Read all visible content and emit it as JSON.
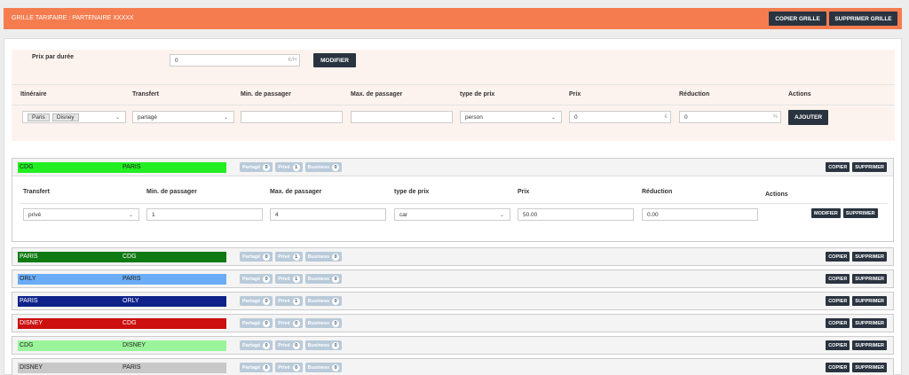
{
  "header": {
    "title": "GRILLE TARIFAIRE :  PARTENAIRE XXXXX",
    "copy_label": "COPIER GRILLE",
    "delete_label": "SUPPRIMER GRILLE"
  },
  "price_duration": {
    "label": "Prix par durée",
    "value": "0",
    "unit": "€/H",
    "button": "MODIFIER"
  },
  "form": {
    "headers": [
      "Itinéraire",
      "Transfert",
      "Min. de passager",
      "Max. de passager",
      "type de prix",
      "Prix",
      "Réduction",
      "Actions"
    ],
    "itinerary_tags": [
      "Paris",
      "Disney"
    ],
    "transfert": "partagé",
    "min": "",
    "max": "",
    "price_type": "person",
    "price": "0",
    "price_unit": "€",
    "reduction": "0",
    "reduction_unit": "%",
    "add_button": "AJOUTER"
  },
  "badge_labels": {
    "partage": "Partagé",
    "prive": "Privé",
    "business": "Business"
  },
  "route_buttons": {
    "copy": "COPIER",
    "delete": "SUPPRIMER"
  },
  "routes": [
    {
      "from": "CDG",
      "to": "PARIS",
      "color": "#22ee22",
      "text": "#222222",
      "partage": "0",
      "prive": "1",
      "business": "0"
    },
    {
      "from": "PARIS",
      "to": "CDG",
      "color": "#0f7a12",
      "text": "#ffffff",
      "partage": "0",
      "prive": "1",
      "business": "0"
    },
    {
      "from": "ORLY",
      "to": "PARIS",
      "color": "#6aacf5",
      "text": "#222222",
      "partage": "0",
      "prive": "1",
      "business": "0"
    },
    {
      "from": "PARIS",
      "to": "ORLY",
      "color": "#0f228a",
      "text": "#ffffff",
      "partage": "0",
      "prive": "1",
      "business": "0"
    },
    {
      "from": "DISNEY",
      "to": "CDG",
      "color": "#cc0f0f",
      "text": "#ffffff",
      "partage": "0",
      "prive": "0",
      "business": "0"
    },
    {
      "from": "CDG",
      "to": "DISNEY",
      "color": "#9af59a",
      "text": "#222222",
      "partage": "0",
      "prive": "0",
      "business": "0"
    },
    {
      "from": "DISNEY",
      "to": "PARIS",
      "color": "#c8c8c8",
      "text": "#222222",
      "partage": "0",
      "prive": "0",
      "business": "0"
    }
  ],
  "detail": {
    "headers": [
      "Transfert",
      "Min. de passager",
      "Max. de passager",
      "type de prix",
      "Prix",
      "Réduction",
      "Actions"
    ],
    "transfert": "privé",
    "min": "1",
    "max": "4",
    "price_type": "car",
    "price": "50.00",
    "reduction": "0.00",
    "modify": "MODIFIER",
    "delete": "SUPPRIMER"
  }
}
